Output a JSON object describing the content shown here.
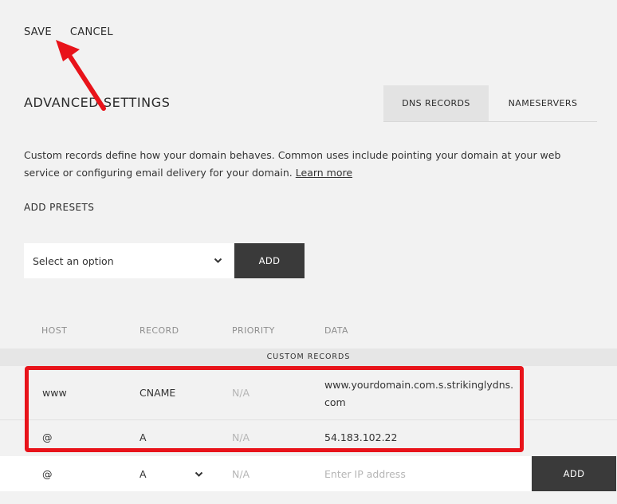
{
  "toolbar": {
    "save_label": "SAVE",
    "cancel_label": "CANCEL"
  },
  "header": {
    "title": "ADVANCED SETTINGS"
  },
  "tabs": [
    {
      "label": "DNS RECORDS",
      "active": true
    },
    {
      "label": "NAMESERVERS",
      "active": false
    }
  ],
  "description": {
    "text": "Custom records define how your domain behaves. Common uses include pointing your domain at your web service or configuring email delivery for your domain.",
    "link": "Learn more"
  },
  "presets": {
    "label": "ADD PRESETS",
    "select_value": "Select an option",
    "add_label": "ADD"
  },
  "table": {
    "columns": [
      "HOST",
      "RECORD",
      "PRIORITY",
      "DATA"
    ],
    "section_label": "CUSTOM RECORDS",
    "rows": [
      {
        "host": "www",
        "record": "CNAME",
        "priority": "N/A",
        "data": "www.yourdomain.com.s.strikinglydns.com"
      },
      {
        "host": "@",
        "record": "A",
        "priority": "N/A",
        "data": "54.183.102.22"
      }
    ],
    "new_row": {
      "host": "@",
      "record": "A",
      "priority": "N/A",
      "data_placeholder": "Enter IP address",
      "add_label": "ADD"
    }
  },
  "annotation": {
    "highlight_color": "#e8131a",
    "arrow_color": "#e8131a"
  },
  "icons": {
    "select_chevron": "chevron-down-icon",
    "record_chevron": "chevron-down-icon"
  }
}
